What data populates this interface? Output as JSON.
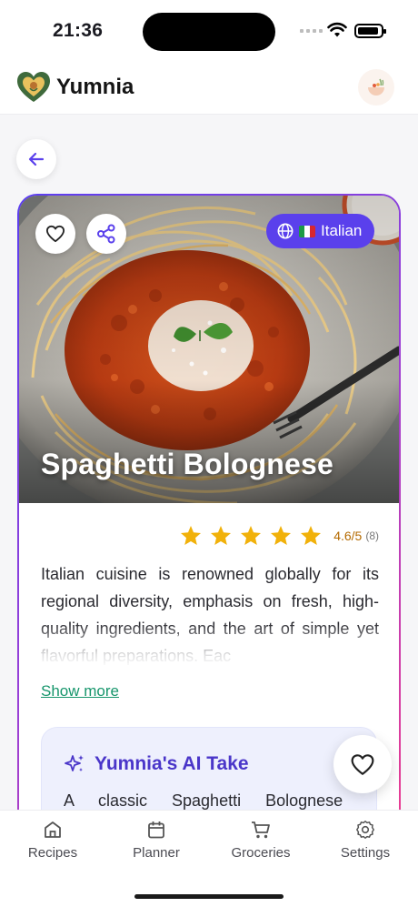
{
  "status": {
    "time": "21:36"
  },
  "app": {
    "name": "Yumnia"
  },
  "recipe": {
    "title": "Spaghetti Bolognese",
    "cuisine": "Italian",
    "rating_value": "4.6/5",
    "rating_count": "(8)",
    "stars": 5,
    "description": "Italian cuisine is renowned globally for its regional diversity, emphasis on fresh, high-quality ingredients, and the art of simple yet flavorful preparations. Eac",
    "show_more": "Show more"
  },
  "ai": {
    "title": "Yumnia's AI Take",
    "text": "A classic Spaghetti Bolognese"
  },
  "tabs": [
    {
      "label": "Recipes",
      "icon": "home-icon"
    },
    {
      "label": "Planner",
      "icon": "calendar-icon"
    },
    {
      "label": "Groceries",
      "icon": "cart-icon"
    },
    {
      "label": "Settings",
      "icon": "gear-icon"
    }
  ],
  "colors": {
    "accent": "#5a40ec",
    "star": "#f1b10a",
    "link": "#17966c",
    "gradient_start": "#5b3ff0",
    "gradient_end": "#ee3d8e"
  }
}
